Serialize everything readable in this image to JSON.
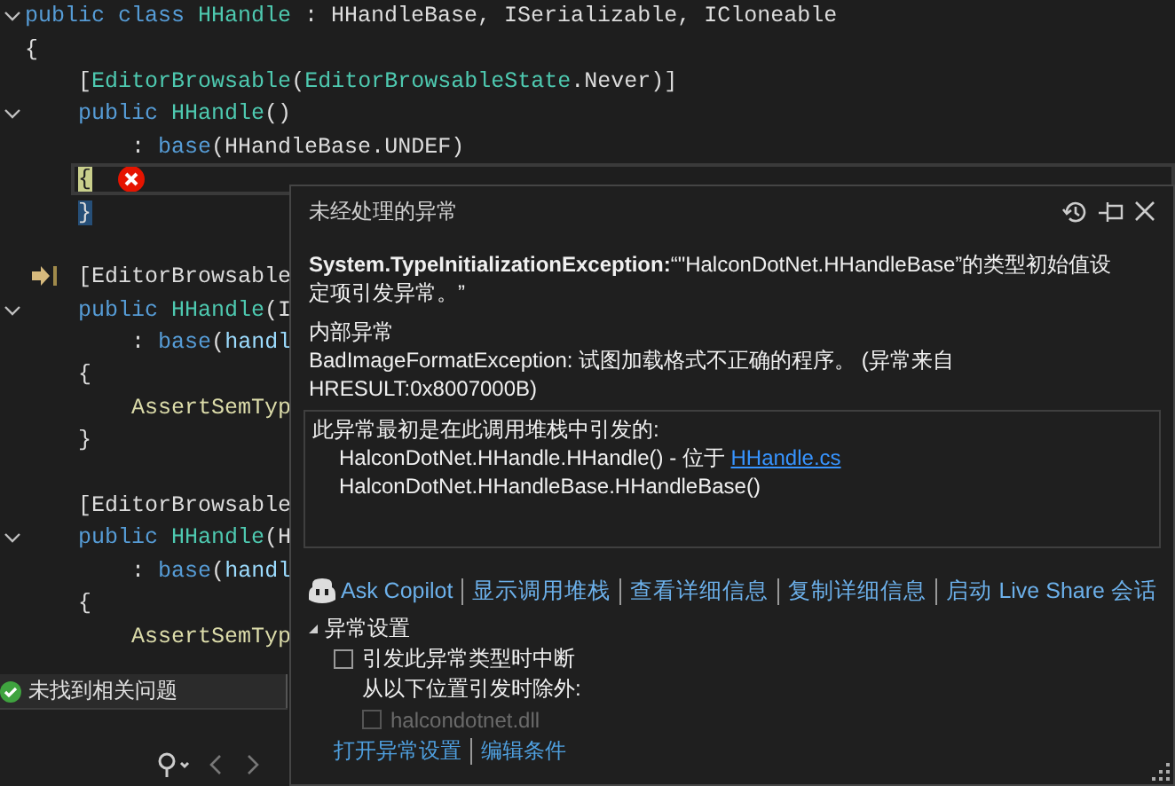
{
  "editor": {
    "lines": [
      {
        "kind": "code",
        "fold": true,
        "current": false,
        "tokens": [
          {
            "text": "public class",
            "kind": "keyword"
          },
          {
            "text": " HHandle",
            "kind": "type"
          },
          {
            "text": " : HHandleBase, ISerializable, ICloneable"
          }
        ]
      },
      {
        "kind": "code",
        "fold": false,
        "current": false,
        "tokens": [
          {
            "text": "{"
          }
        ]
      },
      {
        "kind": "code",
        "fold": false,
        "current": false,
        "tokens": [
          {
            "text": "    ["
          },
          {
            "text": "EditorBrowsable",
            "kind": "type"
          },
          {
            "text": "("
          },
          {
            "text": "EditorBrowsableState",
            "kind": "type"
          },
          {
            "text": ".Never)]"
          }
        ]
      },
      {
        "kind": "code",
        "fold": true,
        "current": false,
        "tokens": [
          {
            "text": "    public",
            "kind": "keyword"
          },
          {
            "text": " HHandle",
            "kind": "type"
          },
          {
            "text": "()"
          }
        ]
      },
      {
        "kind": "code",
        "fold": false,
        "current": false,
        "tokens": [
          {
            "text": "        : "
          },
          {
            "text": "base",
            "kind": "keyword"
          },
          {
            "text": "(HHandleBase.UNDEF)"
          }
        ]
      },
      {
        "kind": "error",
        "fold": false,
        "current": true,
        "tokens": [
          {
            "text": "    {",
            "kind": "brace-current"
          }
        ]
      },
      {
        "kind": "code",
        "fold": false,
        "current": false,
        "tokens": [
          {
            "text": "    }",
            "kind": "brace-match"
          }
        ]
      },
      {
        "kind": "blank",
        "fold": false,
        "current": false
      },
      {
        "kind": "next-statement",
        "fold": false,
        "current": false,
        "tokens": [
          {
            "text": "    [EditorBrowsable"
          }
        ]
      },
      {
        "kind": "code",
        "fold": true,
        "current": false,
        "tokens": [
          {
            "text": "    public",
            "kind": "keyword"
          },
          {
            "text": " HHandle",
            "kind": "type"
          },
          {
            "text": "(I"
          }
        ]
      },
      {
        "kind": "code",
        "fold": false,
        "current": false,
        "tokens": [
          {
            "text": "        : "
          },
          {
            "text": "base",
            "kind": "keyword"
          },
          {
            "text": "("
          },
          {
            "text": "handl",
            "kind": "param"
          }
        ]
      },
      {
        "kind": "code",
        "fold": false,
        "current": false,
        "tokens": [
          {
            "text": "    {"
          }
        ]
      },
      {
        "kind": "code",
        "fold": false,
        "current": false,
        "tokens": [
          {
            "text": "        AssertSemTyp",
            "kind": "method"
          }
        ]
      },
      {
        "kind": "code",
        "fold": false,
        "current": false,
        "tokens": [
          {
            "text": "    }"
          }
        ]
      },
      {
        "kind": "blank",
        "fold": false,
        "current": false
      },
      {
        "kind": "code",
        "fold": false,
        "current": false,
        "tokens": [
          {
            "text": "    [EditorBrowsable"
          }
        ]
      },
      {
        "kind": "code",
        "fold": true,
        "current": false,
        "tokens": [
          {
            "text": "    public",
            "kind": "keyword"
          },
          {
            "text": " HHandle",
            "kind": "type"
          },
          {
            "text": "(H"
          }
        ]
      },
      {
        "kind": "code",
        "fold": false,
        "current": false,
        "tokens": [
          {
            "text": "        : "
          },
          {
            "text": "base",
            "kind": "keyword"
          },
          {
            "text": "("
          },
          {
            "text": "handl",
            "kind": "param"
          }
        ]
      },
      {
        "kind": "code",
        "fold": false,
        "current": false,
        "tokens": [
          {
            "text": "    {"
          }
        ]
      },
      {
        "kind": "code",
        "fold": false,
        "current": false,
        "tokens": [
          {
            "text": "        AssertSemTyp",
            "kind": "method"
          }
        ]
      }
    ]
  },
  "status_bar": {
    "text": "未找到相关问题"
  },
  "exception_popup": {
    "title": "未经处理的异常",
    "message": "**System.TypeInitializationException:**“\"HalconDotNet.HHandleBase”的类型初始值设定项引发异常。”",
    "inner_heading": "内部异常",
    "inner_message": "BadImageFormatException: 试图加载格式不正确的程序。 (异常来自 HRESULT:0x8007000B)",
    "stack_heading": "此异常最初是在此调用堆栈中引发的:",
    "stack_frames": [
      {
        "text": "HalconDotNet.HHandle.HHandle() - 位于 ",
        "link": "HHandle.cs"
      },
      {
        "text": "HalconDotNet.HHandleBase.HHandleBase()"
      }
    ],
    "actions": [
      {
        "label": "Ask Copilot",
        "kind": "copilot"
      },
      {
        "label": "显示调用堆栈",
        "kind": "link"
      },
      {
        "label": "查看详细信息",
        "kind": "link"
      },
      {
        "label": "复制详细信息",
        "kind": "link"
      },
      {
        "label": "启动 Live Share 会话",
        "kind": "link"
      }
    ],
    "settings": {
      "title": "异常设置",
      "expanded": true,
      "break_option": {
        "label": "引发此异常类型时中断",
        "checked": false
      },
      "except_label": "从以下位置引发时除外:",
      "modules": [
        {
          "label": "halcondotnet.dll",
          "checked": false,
          "disabled": true
        }
      ],
      "links": [
        "打开异常设置",
        "编辑条件"
      ]
    }
  }
}
